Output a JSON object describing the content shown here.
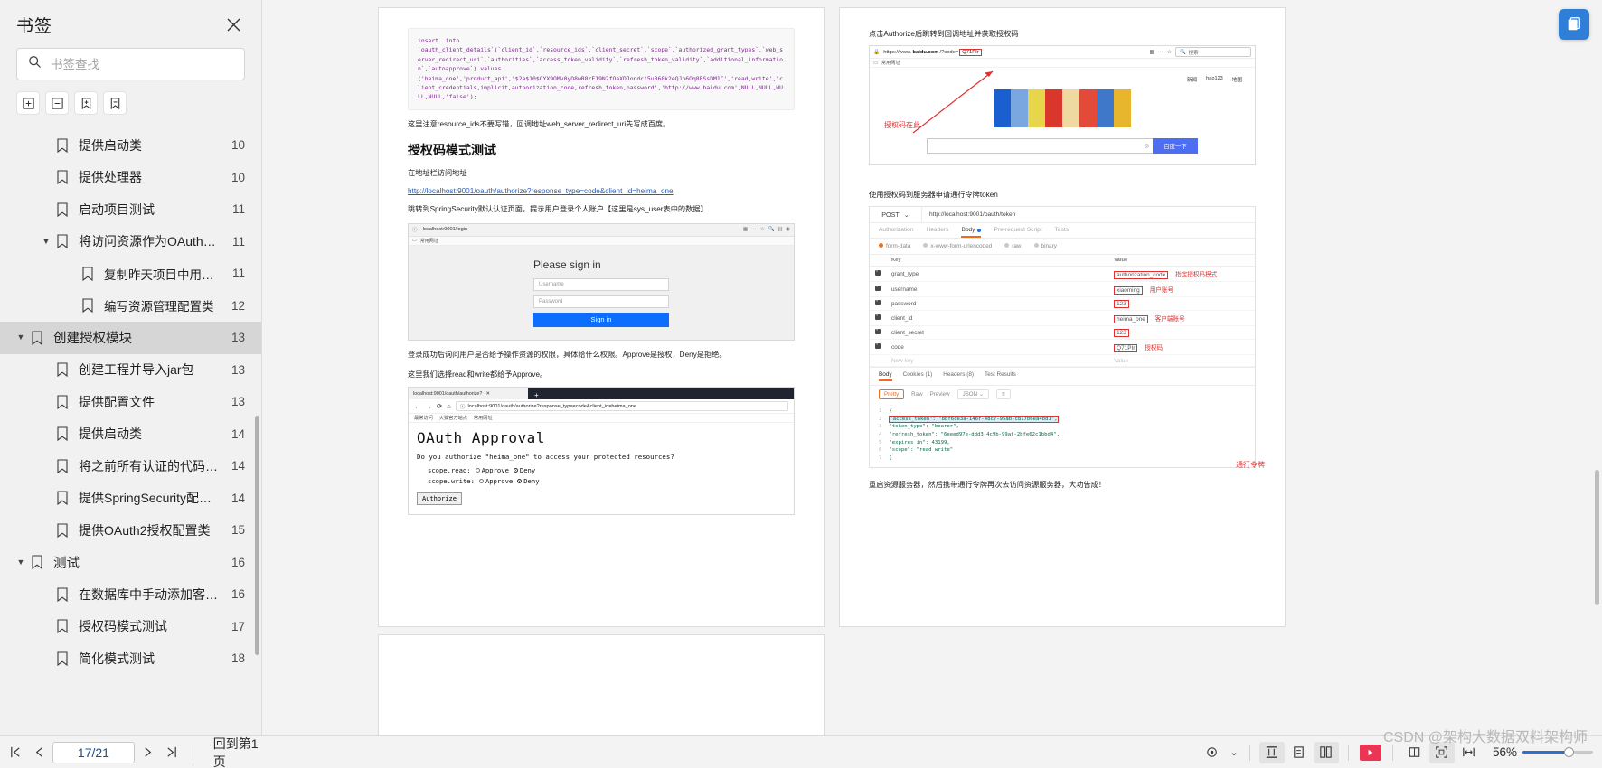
{
  "sidebar": {
    "title": "书签",
    "close_icon": "close-icon",
    "search": {
      "placeholder": "书签查找",
      "value": "",
      "icon": "search-icon"
    },
    "tools": [
      {
        "name": "expand-all-button",
        "icon": "box-plus-icon"
      },
      {
        "name": "collapse-all-button",
        "icon": "box-minus-icon"
      },
      {
        "name": "add-bookmark-button",
        "icon": "bookmark-plus-icon"
      },
      {
        "name": "remove-bookmark-button",
        "icon": "bookmark-minus-icon"
      }
    ],
    "items": [
      {
        "label": "提供启动类",
        "page": "10",
        "level": 1,
        "caret": "",
        "selected": false
      },
      {
        "label": "提供处理器",
        "page": "10",
        "level": 1,
        "caret": "",
        "selected": false
      },
      {
        "label": "启动项目测试",
        "page": "11",
        "level": 1,
        "caret": "",
        "selected": false
      },
      {
        "label": "将访问资源作为OAuth…",
        "page": "11",
        "level": 1,
        "caret": "▼",
        "selected": false
      },
      {
        "label": "复制昨天项目中用户…",
        "page": "11",
        "level": 2,
        "caret": "",
        "selected": false
      },
      {
        "label": "编写资源管理配置类",
        "page": "12",
        "level": 2,
        "caret": "",
        "selected": false
      },
      {
        "label": "创建授权模块",
        "page": "13",
        "level": 0,
        "caret": "▼",
        "selected": true
      },
      {
        "label": "创建工程并导入jar包",
        "page": "13",
        "level": 1,
        "caret": "",
        "selected": false
      },
      {
        "label": "提供配置文件",
        "page": "13",
        "level": 1,
        "caret": "",
        "selected": false
      },
      {
        "label": "提供启动类",
        "page": "14",
        "level": 1,
        "caret": "",
        "selected": false
      },
      {
        "label": "将之前所有认证的代码…",
        "page": "14",
        "level": 1,
        "caret": "",
        "selected": false
      },
      {
        "label": "提供SpringSecurity配…",
        "page": "14",
        "level": 1,
        "caret": "",
        "selected": false
      },
      {
        "label": "提供OAuth2授权配置类",
        "page": "15",
        "level": 1,
        "caret": "",
        "selected": false
      },
      {
        "label": "测试",
        "page": "16",
        "level": 0,
        "caret": "▼",
        "selected": false
      },
      {
        "label": "在数据库中手动添加客户…",
        "page": "16",
        "level": 1,
        "caret": "",
        "selected": false
      },
      {
        "label": "授权码模式测试",
        "page": "17",
        "level": 1,
        "caret": "",
        "selected": false
      },
      {
        "label": "简化模式测试",
        "page": "18",
        "level": 1,
        "caret": "",
        "selected": false
      }
    ]
  },
  "page_left": {
    "code_block": "insert  into\n`oauth_client_details`(`client_id`,`resource_ids`,`client_secret`,`scope`,`authorized_grant_types`,`web_server_redirect_uri`,`authorities`,`access_token_validity`,`refresh_token_validity`,`additional_information`,`autoapprove`) values\n('heima_one','product_api','$2a$10$CYX9OMv0yO8wR8rE19N2fOaXDJondci5uR68k2eQJn6Oq8ESsDM1C','read,write','client_credentials,implicit,authorization_code,refresh_token,password','http://www.baidu.com',NULL,NULL,NULL,NULL,'false');",
    "note1": "这里注意resource_ids不要写错，回调地址web_server_redirect_uri先写成百度。",
    "heading": "授权码模式测试",
    "note2": "在地址栏访问地址",
    "link": "http://localhost:9001/oauth/authorize?response_type=code&client_id=heima_one",
    "note3": "跳转到SpringSecurity默认认证页面，提示用户登录个人账户【这里是sys_user表中的数据】",
    "login_shot": {
      "url": "localhost:9001/login",
      "bookmarks_label": "常用网址",
      "title": "Please sign in",
      "username_placeholder": "Username",
      "password_placeholder": "Password",
      "signin_label": "Sign in"
    },
    "note4": "登录成功后询问用户是否给予操作资源的权限，具体给什么权限。Approve是授权，Deny是拒绝。",
    "note5": "这里我们选择read和write都给予Approve。",
    "approval_shot": {
      "tab_title": "localhost:9001/oauth/authorize?",
      "address": "localhost:9001/oauth/authorize?response_type=code&client_id=heima_one",
      "bookmarks": [
        "最常访问",
        "火狐官方站点",
        "常用网址"
      ],
      "heading": "OAuth Approval",
      "question": "Do you authorize \"heima_one\" to access your protected resources?",
      "scopes": [
        {
          "label": "scope.read:",
          "approve": "Approve",
          "deny": "Deny",
          "selected": "Deny"
        },
        {
          "label": "scope.write:",
          "approve": "Approve",
          "deny": "Deny",
          "selected": "Deny"
        }
      ],
      "submit_label": "Authorize"
    }
  },
  "page_right": {
    "note1": "点击Authorize后跳转到回调地址并获取授权码",
    "baidu_shot": {
      "url_prefix": "https://www.",
      "url_domain": "baidu.com",
      "url_query": "/?code=",
      "code_value": "Q71PIr",
      "bookmarks_label": "常用网址",
      "search_placeholder": "搜索",
      "top_links": [
        "新闻",
        "hao123",
        "地图"
      ],
      "search_button": "百度一下"
    },
    "annotation1": "授权码在此",
    "note2": "使用授权码到服务器申请通行令牌token",
    "postman": {
      "method": "POST",
      "url": "http://localhost:9001/oauth/token",
      "tabs": [
        "Authorization",
        "Headers",
        "Body",
        "Pre-request Script",
        "Tests"
      ],
      "active_tab": "Body",
      "body_types": [
        "form-data",
        "x-www-form-urlencoded",
        "raw",
        "binary"
      ],
      "active_body_type": "form-data",
      "columns": [
        "Key",
        "Value"
      ],
      "rows": [
        {
          "checked": true,
          "key": "grant_type",
          "value": "authorization_code",
          "boxed": true,
          "note": "指定授权码模式"
        },
        {
          "checked": true,
          "key": "username",
          "value": "xiaoming",
          "boxed": true,
          "note": "用户账号"
        },
        {
          "checked": true,
          "key": "password",
          "value": "123",
          "boxed": true,
          "note": ""
        },
        {
          "checked": true,
          "key": "client_id",
          "value": "heima_one",
          "boxed": true,
          "note": "客户端账号"
        },
        {
          "checked": true,
          "key": "client_secret",
          "value": "123",
          "boxed": true,
          "note": ""
        },
        {
          "checked": true,
          "key": "code",
          "value": "Q71PIr",
          "boxed": true,
          "note": "授权码"
        },
        {
          "checked": false,
          "key": "New key",
          "value": "Value",
          "boxed": false,
          "note": ""
        }
      ],
      "response_tabs": [
        "Body",
        "Cookies (1)",
        "Headers (8)",
        "Test Results"
      ],
      "response_active": "Body",
      "view_modes": [
        "Pretty",
        "Raw",
        "Preview"
      ],
      "view_active": "Pretty",
      "format": "JSON",
      "json_lines": [
        "{",
        "  \"access_token\": \"8bf6ce3a-146f-48c7-95ab-c817b6ea4bd1\",",
        "  \"token_type\": \"bearer\",",
        "  \"refresh_token\": \"6eeed97e-ddd3-4c9b-99af-2bfe62c1bbd4\",",
        "  \"expires_in\": 43199,",
        "  \"scope\": \"read write\"",
        "}"
      ]
    },
    "annotation2": "通行令牌",
    "note3": "重启资源服务器，然后携带通行令牌再次去访问资源服务器，大功告成！"
  },
  "bottombar": {
    "first_page_icon": "first-page-icon",
    "prev_page_icon": "prev-page-icon",
    "page_value": "17/21",
    "next_page_icon": "next-page-icon",
    "last_page_icon": "last-page-icon",
    "back_to_first": "回到第1页",
    "tools": [
      {
        "name": "view-mode-button",
        "icon": "eye-icon",
        "highlight": false
      },
      {
        "name": "fit-height-button",
        "icon": "fit-height-icon",
        "highlight": true
      },
      {
        "name": "single-page-button",
        "icon": "single-page-icon",
        "highlight": false
      },
      {
        "name": "double-page-button",
        "icon": "double-page-icon",
        "highlight": true
      },
      {
        "name": "slideshow-button",
        "icon": "play-icon",
        "highlight": false
      },
      {
        "name": "page-layout-button",
        "icon": "layout-icon",
        "highlight": false
      },
      {
        "name": "fit-page-button",
        "icon": "fit-page-icon",
        "highlight": true
      },
      {
        "name": "fit-width-button",
        "icon": "fit-width-icon",
        "highlight": false
      }
    ],
    "zoom_level": "56%"
  },
  "watermark": "CSDN @架构大数据双料架构师",
  "float_button_icon": "document-stack-icon",
  "colors": {
    "selection": "#d6d6d6",
    "accent_blue": "#2f7fd8",
    "annotation_red": "#e03030",
    "postman_orange": "#ef6c1f",
    "play_red": "#ea3654"
  }
}
